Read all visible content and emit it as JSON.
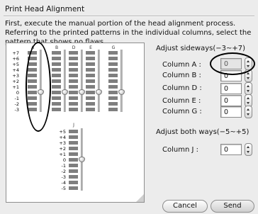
{
  "dialog": {
    "title": "Print Head Alignment",
    "instructions": "First, execute the manual portion of the head alignment process. Referring to the printed patterns in the individual columns, select the pattern that shows no flaws."
  },
  "pattern": {
    "columns": [
      {
        "id": "A",
        "selected": 0
      },
      {
        "id": "B",
        "selected": 0
      },
      {
        "id": "D",
        "selected": 0
      },
      {
        "id": "E",
        "selected": 0
      },
      {
        "id": "G",
        "selected": 0
      }
    ],
    "top_labels": [
      "+7",
      "+6",
      "+5",
      "+4",
      "+3",
      "+2",
      "+1",
      "0",
      "-1",
      "-2",
      "-3"
    ],
    "j_column": {
      "id": "J",
      "selected": 0
    },
    "j_labels": [
      "+5",
      "+4",
      "+3",
      "+2",
      "+1",
      "0",
      "-1",
      "-2",
      "-3",
      "-4",
      "-5"
    ]
  },
  "sideways": {
    "heading": "Adjust sideways(−3~+7)",
    "fields": [
      {
        "label": "Column A :",
        "value": "0"
      },
      {
        "label": "Column B :",
        "value": "0"
      },
      {
        "label": "Column D :",
        "value": "0"
      },
      {
        "label": "Column E :",
        "value": "0"
      },
      {
        "label": "Column G :",
        "value": "0"
      }
    ]
  },
  "both_ways": {
    "heading": "Adjust both ways(−5~+5)",
    "fields": [
      {
        "label": "Column J :",
        "value": "0"
      }
    ]
  },
  "buttons": {
    "cancel": "Cancel",
    "send": "Send"
  }
}
